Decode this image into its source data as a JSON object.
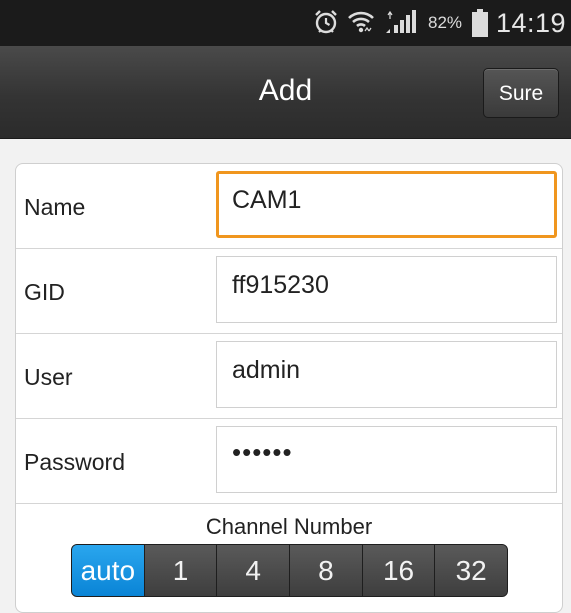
{
  "status_bar": {
    "battery_percent": "82%",
    "time": "14:19",
    "icons": [
      "alarm-icon",
      "wifi-icon",
      "signal-icon",
      "battery-icon"
    ]
  },
  "title_bar": {
    "title": "Add",
    "sure_label": "Sure"
  },
  "form": {
    "fields": [
      {
        "label": "Name",
        "value": "CAM1",
        "focused": true
      },
      {
        "label": "GID",
        "value": "ff915230"
      },
      {
        "label": "User",
        "value": "admin"
      },
      {
        "label": "Password",
        "value": "••••••",
        "masked": true
      }
    ],
    "channel_number": {
      "label": "Channel Number",
      "options": [
        "auto",
        "1",
        "4",
        "8",
        "16",
        "32"
      ],
      "selected": "auto"
    }
  },
  "colors": {
    "focus_border": "#f0961e",
    "selected_segment": "#1a96e2",
    "title_bar": "#343434"
  }
}
